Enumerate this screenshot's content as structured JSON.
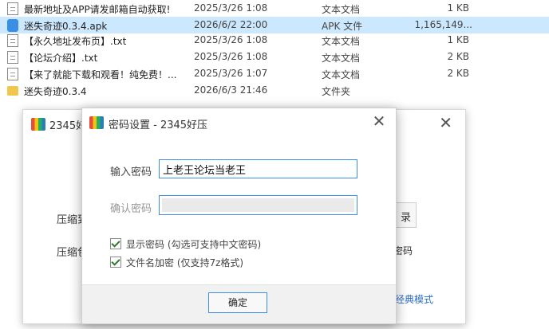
{
  "files": [
    {
      "name": "最新地址及APP请发邮箱自动获取!",
      "date": "2025/3/26 1:08",
      "type": "文本文档",
      "size": "1 KB",
      "icon": "text-file-icon",
      "selected": false
    },
    {
      "name": "迷失奇迹0.3.4.apk",
      "date": "2026/6/2 22:00",
      "type": "APK 文件",
      "size": "1,165,149...",
      "icon": "apk-file-icon",
      "selected": true
    },
    {
      "name": "【永久地址发布页】.txt",
      "date": "2025/3/26 1:08",
      "type": "文本文档",
      "size": "1 KB",
      "icon": "text-file-icon",
      "selected": false
    },
    {
      "name": "【论坛介绍】.txt",
      "date": "2025/3/26 1:08",
      "type": "文本文档",
      "size": "2 KB",
      "icon": "text-file-icon",
      "selected": false
    },
    {
      "name": "【来了就能下载和观看！纯免费！...",
      "date": "2025/3/26 1:07",
      "type": "文本文档",
      "size": "2 KB",
      "icon": "text-file-icon",
      "selected": false
    },
    {
      "name": "迷失奇迹0.3.4",
      "date": "2026/6/3 21:46",
      "type": "文件夹",
      "size": "",
      "icon": "folder-icon",
      "selected": false
    }
  ],
  "background_window": {
    "title": "2345好",
    "close": "✕",
    "label_compress_to": "压缩到",
    "label_compress_name": "压缩包",
    "browse_button": "录",
    "password_button": "密码",
    "classic_mode_link": "经典模式"
  },
  "dialog": {
    "title": "密码设置 - 2345好压",
    "close": "✕",
    "password_label": "输入密码",
    "password_value": "上老王论坛当老王",
    "confirm_label": "确认密码",
    "show_password_label": "显示密码 (勾选可支持中文密码)",
    "show_password_checked": true,
    "encrypt_filename_label": "文件名加密  (仅支持7z格式)",
    "encrypt_filename_checked": true,
    "ok_button": "确定"
  },
  "colors": {
    "selection": "#cce8ff",
    "accent_border": "#3d8de2",
    "link": "#2a6ec7"
  }
}
